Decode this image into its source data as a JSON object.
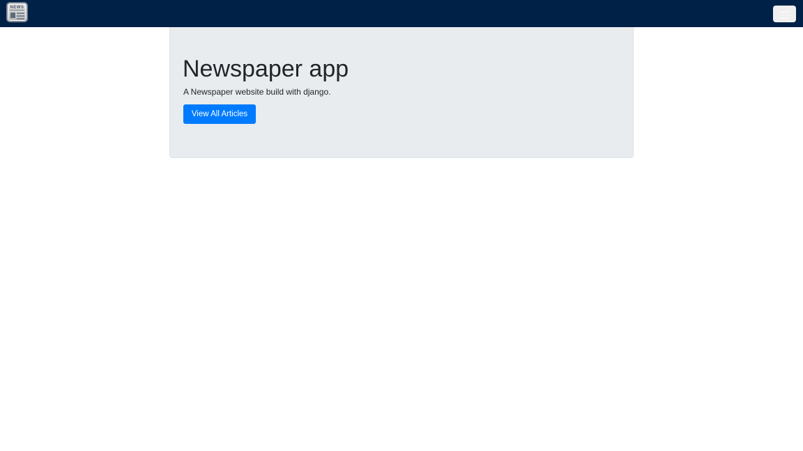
{
  "navbar": {
    "logo_icon": "newspaper-icon",
    "logo_text": "NEWS",
    "toggler_icon": "hamburger-menu-icon",
    "background_color": "#002147"
  },
  "jumbotron": {
    "title": "Newspaper app",
    "lead": "A Newspaper website build with django.",
    "button_label": "View All Articles",
    "background_color": "#e9ecef",
    "button_color": "#007bff"
  }
}
